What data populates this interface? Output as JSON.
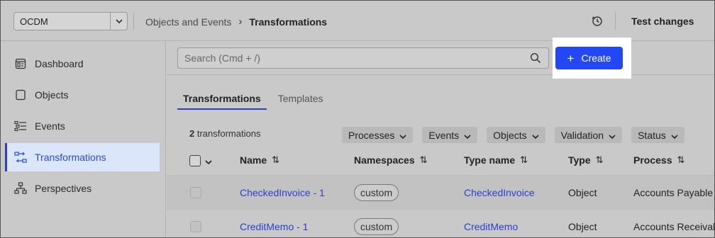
{
  "header": {
    "workspace": "OCDM",
    "breadcrumb": [
      "Objects and Events",
      "Transformations"
    ],
    "test_changes": "Test changes"
  },
  "sidebar": {
    "items": [
      {
        "label": "Dashboard",
        "icon": "dashboard-icon"
      },
      {
        "label": "Objects",
        "icon": "object-icon"
      },
      {
        "label": "Events",
        "icon": "events-icon"
      },
      {
        "label": "Transformations",
        "icon": "transformations-icon",
        "active": true
      },
      {
        "label": "Perspectives",
        "icon": "perspectives-icon"
      }
    ]
  },
  "search": {
    "placeholder": "Search (Cmd + /)"
  },
  "create": {
    "label": "Create"
  },
  "tabs": [
    "Transformations",
    "Templates"
  ],
  "count": {
    "number": "2",
    "label": "transformations"
  },
  "filters": [
    "Processes",
    "Events",
    "Objects",
    "Validation",
    "Status"
  ],
  "table": {
    "columns": [
      "Name",
      "Namespaces",
      "Type name",
      "Type",
      "Process"
    ],
    "rows": [
      {
        "name": "CheckedInvoice - 1",
        "namespace": "custom",
        "type_name": "CheckedInvoice",
        "type": "Object",
        "process": "Accounts Payable"
      },
      {
        "name": "CreditMemo - 1",
        "namespace": "custom",
        "type_name": "CreditMemo",
        "type": "Object",
        "process": "Accounts Receivable"
      }
    ]
  },
  "colors": {
    "accent": "#2347f5",
    "link": "#2a3fd0",
    "active_bg": "#dbe6fb"
  }
}
